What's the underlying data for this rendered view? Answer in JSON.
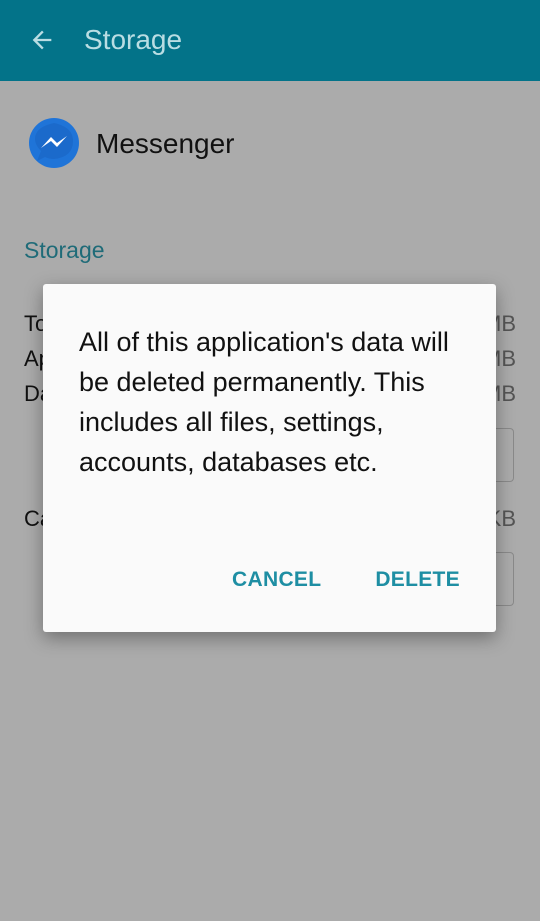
{
  "appbar": {
    "title": "Storage",
    "back_icon": "arrow-back-icon"
  },
  "app": {
    "name": "Messenger",
    "icon": "messenger-icon"
  },
  "storage": {
    "section_title": "Storage",
    "rows": [
      {
        "label": "To",
        "value": "MB"
      },
      {
        "label": "Ap",
        "value": "MB"
      },
      {
        "label": "Da",
        "value": "MB"
      },
      {
        "label": "Ca",
        "value": "KB"
      }
    ]
  },
  "dialog": {
    "message": "All of this application's data will be deleted permanently. This includes all files, settings, accounts, databases etc.",
    "cancel_label": "CANCEL",
    "delete_label": "DELETE"
  },
  "colors": {
    "appbar": "#037389",
    "accent": "#1e8ea3",
    "scrim_background": "#ababab"
  }
}
